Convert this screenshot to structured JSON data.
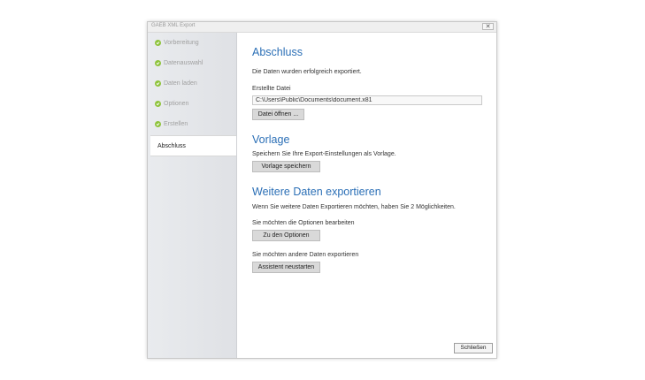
{
  "window": {
    "title": "GAEB XML Export",
    "close_glyph": "✕"
  },
  "sidebar": {
    "items": [
      {
        "label": "Vorbereitung",
        "done": true
      },
      {
        "label": "Datenauswahl",
        "done": true
      },
      {
        "label": "Daten laden",
        "done": true
      },
      {
        "label": "Optionen",
        "done": true
      },
      {
        "label": "Erstellen",
        "done": true
      },
      {
        "label": "Abschluss",
        "done": false,
        "active": true
      }
    ]
  },
  "main": {
    "section1": {
      "heading": "Abschluss",
      "message": "Die Daten wurden erfolgreich exportiert.",
      "file_label": "Erstellte Datei",
      "file_path": "C:\\Users\\Public\\Documents\\document.x81",
      "open_button": "Datei öffnen ..."
    },
    "section2": {
      "heading": "Vorlage",
      "message": "Speichern Sie Ihre Export-Einstellungen als Vorlage.",
      "save_button": "Vorlage speichern"
    },
    "section3": {
      "heading": "Weitere Daten exportieren",
      "message": "Wenn Sie weitere Daten Exportieren möchten, haben Sie 2 Möglichkeiten.",
      "options_label": "Sie möchten die Optionen bearbeiten",
      "options_button": "Zu den Optionen",
      "other_label": "Sie möchten andere Daten exportieren",
      "restart_button": "Assistent neustarten"
    },
    "close_button": "Schließen"
  },
  "colors": {
    "accent": "#2b6fb6",
    "check": "#8ec33b"
  }
}
